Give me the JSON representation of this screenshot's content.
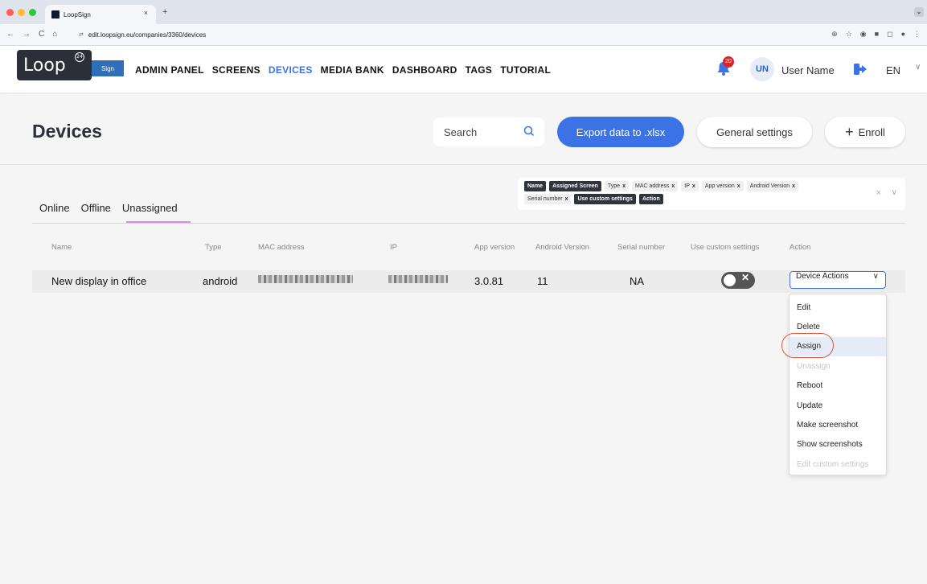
{
  "browser": {
    "tab_title": "LoopSign",
    "tab_close": "×",
    "new_tab": "+",
    "url": "edit.loopsign.eu/companies/3360/devices",
    "nav_back": "←",
    "nav_forward": "→",
    "nav_reload": "C",
    "nav_home": "⌂",
    "window_controls_colors": [
      "#ff5f57",
      "#febc2e",
      "#28c840"
    ]
  },
  "header": {
    "logo_text": "Loop",
    "logo_badge": "24",
    "sign_label": "Sign",
    "nav": [
      {
        "label": "ADMIN PANEL",
        "active": false
      },
      {
        "label": "SCREENS",
        "active": false
      },
      {
        "label": "DEVICES",
        "active": true
      },
      {
        "label": "MEDIA BANK",
        "active": false
      },
      {
        "label": "DASHBOARD",
        "active": false
      },
      {
        "label": "TAGS",
        "active": false
      },
      {
        "label": "TUTORIAL",
        "active": false
      }
    ],
    "notifications_count": "20",
    "avatar_initials": "UN",
    "user_name": "User Name",
    "language": "EN"
  },
  "page": {
    "title": "Devices",
    "search_placeholder": "Search",
    "export_button": "Export data to .xlsx",
    "general_settings_button": "General settings",
    "enroll_plus": "+",
    "enroll_button": "Enroll"
  },
  "tabs": [
    {
      "label": "Online",
      "active": false
    },
    {
      "label": "Offline",
      "active": false
    },
    {
      "label": "Unassigned",
      "active": true
    }
  ],
  "column_filter": {
    "chips": [
      {
        "label": "Name",
        "selected": true,
        "removable": false
      },
      {
        "label": "Assigned Screen",
        "selected": true,
        "removable": false
      },
      {
        "label": "Type",
        "selected": false,
        "removable": true
      },
      {
        "label": "MAC address",
        "selected": false,
        "removable": true
      },
      {
        "label": "IP",
        "selected": false,
        "removable": true
      },
      {
        "label": "App version",
        "selected": false,
        "removable": true
      },
      {
        "label": "Android Version",
        "selected": false,
        "removable": true
      },
      {
        "label": "Serial number",
        "selected": false,
        "removable": true
      },
      {
        "label": "Use custom settings",
        "selected": true,
        "removable": false
      },
      {
        "label": "Action",
        "selected": true,
        "removable": false
      }
    ],
    "chip_remove": "x",
    "clear": "×",
    "chevron": "∨"
  },
  "table": {
    "columns": [
      "Name",
      "Type",
      "MAC address",
      "IP",
      "App version",
      "Android Version",
      "Serial number",
      "Use custom settings",
      "Action"
    ],
    "rows": [
      {
        "name": "New display in office",
        "type": "android",
        "app_version": "3.0.81",
        "android_version": "11",
        "serial_number": "NA",
        "use_custom_settings": false,
        "action": "Device Actions"
      }
    ],
    "toggle_off_glyph": "✕"
  },
  "device_actions_menu": {
    "items": [
      {
        "label": "Edit",
        "disabled": false,
        "highlighted": false
      },
      {
        "label": "Delete",
        "disabled": false,
        "highlighted": false
      },
      {
        "label": "Assign",
        "disabled": false,
        "highlighted": true
      },
      {
        "label": "Unassign",
        "disabled": true,
        "highlighted": false
      },
      {
        "label": "Reboot",
        "disabled": false,
        "highlighted": false
      },
      {
        "label": "Update",
        "disabled": false,
        "highlighted": false
      },
      {
        "label": "Make screenshot",
        "disabled": false,
        "highlighted": false
      },
      {
        "label": "Show screenshots",
        "disabled": false,
        "highlighted": false
      },
      {
        "label": "Edit custom settings",
        "disabled": true,
        "highlighted": false
      }
    ]
  },
  "colors": {
    "accent": "#3b73e6",
    "active_tab_underline": "#d58ee0",
    "highlight_circle": "#e2553c",
    "notification_badge": "#d9252a"
  }
}
